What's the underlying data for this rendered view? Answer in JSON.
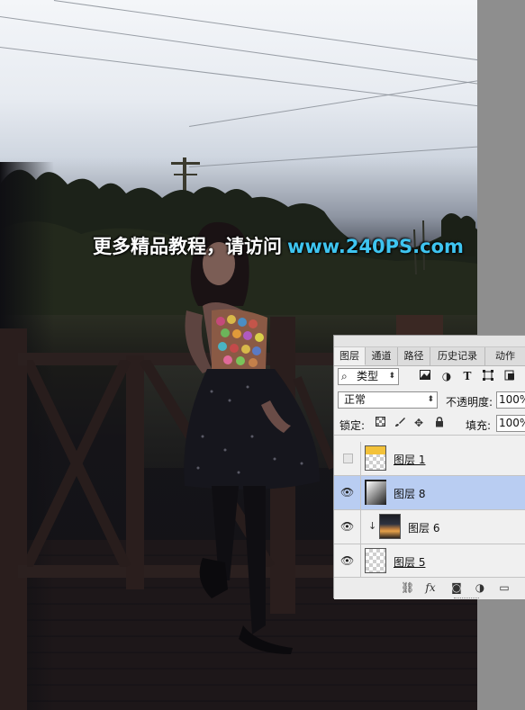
{
  "watermark": {
    "chinese_text": "更多精品教程，请访问",
    "url_text": "www.240PS.com"
  },
  "layers_panel": {
    "tabs": [
      {
        "label": "图层",
        "active": true
      },
      {
        "label": "通道",
        "active": false
      },
      {
        "label": "路径",
        "active": false
      },
      {
        "label": "历史记录",
        "active": false
      },
      {
        "label": "动作",
        "active": false
      }
    ],
    "filter": {
      "prefix_icon": "search-icon",
      "label": "类型",
      "icons": [
        "image-filter-icon",
        "adjustment-filter-icon",
        "type-filter-icon",
        "shape-filter-icon",
        "smart-object-filter-icon"
      ]
    },
    "blend_mode": "正常",
    "opacity_label": "不透明度:",
    "opacity_value": "100%",
    "lock_label": "锁定:",
    "lock_icons": [
      "lock-transparent-pixels-icon",
      "lock-image-pixels-icon",
      "lock-position-icon",
      "lock-all-icon"
    ],
    "fill_label": "填充:",
    "fill_value": "100%",
    "layers": [
      {
        "name": "图层 1",
        "visible": false,
        "selected": false,
        "clipped": false,
        "thumbnail": "yellow-top-transparent"
      },
      {
        "name": "图层 8",
        "visible": true,
        "selected": true,
        "clipped": false,
        "thumbnail": "gradient"
      },
      {
        "name": "图层 6",
        "visible": true,
        "selected": false,
        "clipped": true,
        "thumbnail": "photo"
      },
      {
        "name": "图层 5",
        "visible": true,
        "selected": false,
        "clipped": false,
        "thumbnail": "transparent"
      }
    ],
    "bottom_icons": [
      "link-layers-icon",
      "fx-icon",
      "add-mask-icon",
      "adjustment-layer-icon",
      "new-group-icon"
    ],
    "bottom_glyphs": {
      "link": "⛓",
      "fx": "fx",
      "mask": "◙",
      "adjust": "◑",
      "folder": "▭"
    },
    "eye_glyph": "👁",
    "clip_glyph": "↓",
    "caret_glyph": "⬍",
    "search_glyph": "⌕"
  },
  "colors": {
    "watermark_url": "#3ec4f0",
    "selected_layer": "#b9cdf2"
  }
}
